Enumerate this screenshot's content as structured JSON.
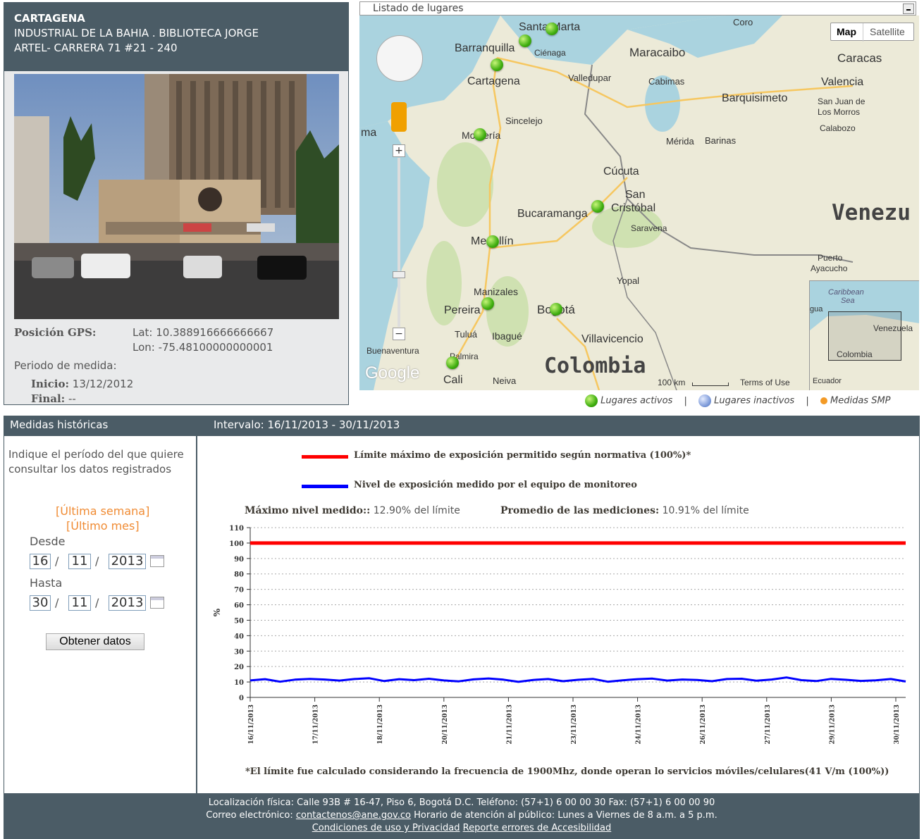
{
  "station": {
    "city": "CARTAGENA",
    "address_line1": "INDUSTRIAL DE LA BAHIA . BIBLIOTECA JORGE",
    "address_line2": "ARTEL- CARRERA 71 #21 - 240",
    "gps_label": "Posición GPS:",
    "lat": "Lat: 10.388916666666667",
    "lon": "Lon: -75.48100000000001",
    "period_label": "Periodo de medida:",
    "start_label": "Inicio:",
    "start_value": "13/12/2012",
    "end_label": "Final:",
    "end_value": "--"
  },
  "map": {
    "select_label": "Listado de lugares",
    "btn_map": "Map",
    "btn_satellite": "Satellite",
    "labels": {
      "santa_marta": "Santa Marta",
      "barranquilla": "Barranquilla",
      "cienaga": "Ciénaga",
      "cartagena": "Cartagena",
      "maracaibo": "Maracaibo",
      "valledupar": "Valledupar",
      "cabimas": "Cabimas",
      "coro": "Coro",
      "caracas": "Caracas",
      "valencia": "Valencia",
      "barquisimeto": "Barquisimeto",
      "san_juan": "San Juan de",
      "los_morros": "Los Morros",
      "calabozo": "Calabozo",
      "sincelejo": "Sincelejo",
      "monteria": "Montería",
      "panama": "ma",
      "merida": "Mérida",
      "barinas": "Barinas",
      "cucuta": "Cúcuta",
      "san": "San",
      "cristobal": "Cristóbal",
      "bucaramanga": "Bucaramanga",
      "saravena": "Saravena",
      "venezuela_big": "Venezu",
      "medellin": "Medellín",
      "puerto": "Puerto",
      "ayacucho": "Ayacucho",
      "yopal": "Yopal",
      "manizales": "Manizales",
      "pereira": "Pereira",
      "bogota": "Bogotá",
      "tulua": "Tuluá",
      "ibague": "Ibagué",
      "villavicencio": "Villavicencio",
      "buenaventura": "Buenaventura",
      "palmira": "Palmira",
      "cali": "Cali",
      "neiva": "Neiva",
      "colombia_big": "Colombia",
      "scale": "100 km",
      "terms": "Terms of Use",
      "google": "Google",
      "caribbean": "Caribbean",
      "sea": "Sea",
      "mini_venezuela": "Venezuela",
      "mini_colombia": "Colombia",
      "mini_ecuador": "Ecuador",
      "mini_gua": "gua"
    },
    "legend_active": "Lugares activos",
    "legend_inactive": "Lugares inactivos",
    "legend_smp": "Medidas SMP",
    "legend_sep": "|"
  },
  "history": {
    "title": "Medidas históricas",
    "interval": "Intervalo: 16/11/2013 - 30/11/2013",
    "intro": "Indique el período del que quiere consultar los datos registrados",
    "last_week": "[Última semana]",
    "last_month": "[Último mes]",
    "from_label": "Desde",
    "to_label": "Hasta",
    "from": {
      "day": "16",
      "month": "11",
      "year": "2013"
    },
    "to": {
      "day": "30",
      "month": "11",
      "year": "2013"
    },
    "slash": "/",
    "button": "Obtener datos"
  },
  "chart_legend": {
    "limit": "Límite máximo de exposición permitido según normativa (100%)*",
    "measured": "Nivel de exposición medido por el equipo de monitoreo",
    "max_key": "Máximo nivel medido::",
    "max_val": "12.90% del límite",
    "avg_key": "Promedio de las mediciones:",
    "avg_val": "10.91% del límite",
    "footnote": "*El límite fue calculado considerando la frecuencia de 1900Mhz, donde operan lo servicios móviles/celulares(41 V/m (100%))",
    "limit_color": "#ff0000",
    "measured_color": "#0000ff"
  },
  "chart_data": {
    "type": "line",
    "ylabel": "%",
    "ylim": [
      0,
      110
    ],
    "yticks": [
      "0",
      "10",
      "20",
      "30",
      "40",
      "50",
      "60",
      "70",
      "80",
      "90",
      "100",
      "110"
    ],
    "xticks": [
      "16/11/2013",
      "17/11/2013",
      "18/11/2013",
      "20/11/2013",
      "21/11/2013",
      "23/11/2013",
      "24/11/2013",
      "26/11/2013",
      "27/11/2013",
      "29/11/2013",
      "30/11/2013"
    ],
    "series": [
      {
        "name": "Límite máximo de exposición permitido según normativa (100%)*",
        "values": [
          100,
          100,
          100,
          100,
          100,
          100,
          100,
          100,
          100,
          100,
          100
        ]
      },
      {
        "name": "Nivel de exposición medido por el equipo de monitoreo",
        "values": [
          11.0,
          11.8,
          10.2,
          11.5,
          12.0,
          11.6,
          10.9,
          11.9,
          12.4,
          10.6,
          11.8,
          11.2,
          12.1,
          11.0,
          10.4,
          11.7,
          12.3,
          11.5,
          10.1,
          11.3,
          11.9,
          10.5,
          11.4,
          12.0,
          10.2,
          11.1,
          11.8,
          12.2,
          10.9,
          11.6,
          11.3,
          10.5,
          11.9,
          12.1,
          10.8,
          11.6,
          12.9,
          11.2,
          10.6,
          12.0,
          11.4,
          10.7,
          11.1,
          11.9,
          10.3
        ]
      }
    ]
  },
  "footer": {
    "line1": "Localización física: Calle 93B # 16-47, Piso 6, Bogotá D.C. Teléfono: (57+1) 6 00 00 30 Fax: (57+1) 6 00 00 90",
    "email_prefix": "Correo electrónico:",
    "email": "contactenos@ane.gov.co",
    "hours": "Horario de atención al público: Lunes a Viernes de 8 a.m. a 5 p.m.",
    "link1": "Condiciones de uso y Privacidad",
    "link2": "Reporte errores de Accesibilidad"
  }
}
